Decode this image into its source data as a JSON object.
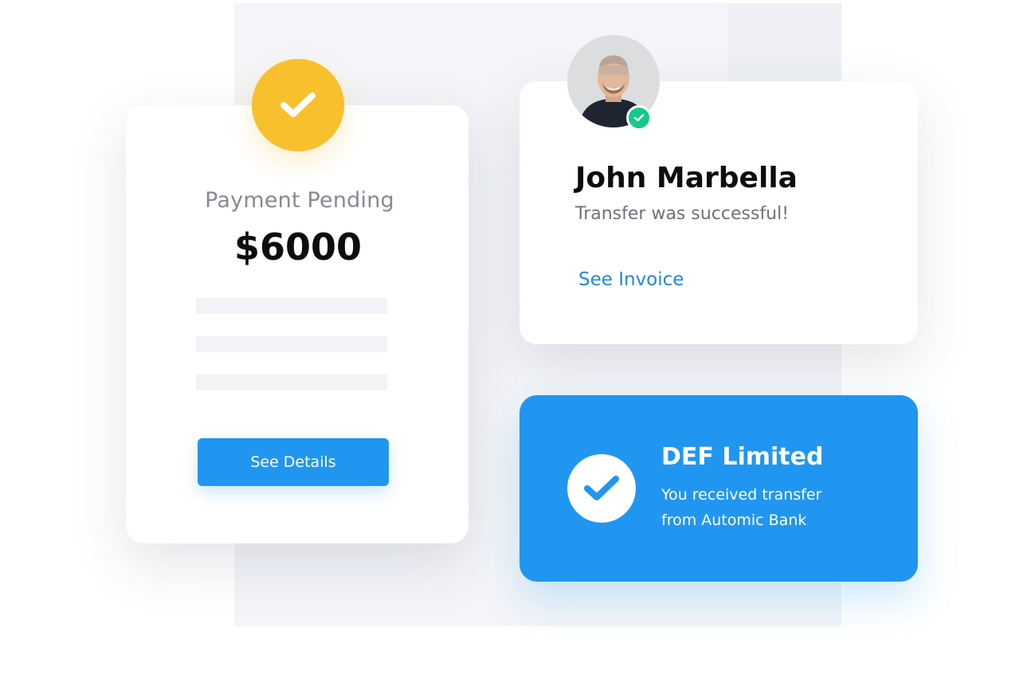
{
  "colors": {
    "accent": "#2196f0",
    "pending": "#f9c02e",
    "success": "#15c98a",
    "link": "#2387e0"
  },
  "payment_card": {
    "status_icon": "check-icon",
    "title": "Payment Pending",
    "amount": "$6000",
    "button_label": "See Details"
  },
  "profile_card": {
    "avatar_icon": "avatar",
    "verified_icon": "check-icon",
    "name": "John Marbella",
    "message": "Transfer was successful!",
    "link_label": "See Invoice"
  },
  "notification_card": {
    "status_icon": "check-icon",
    "title": "DEF Limited",
    "line1": "You received transfer",
    "line2": "from Automic Bank"
  }
}
